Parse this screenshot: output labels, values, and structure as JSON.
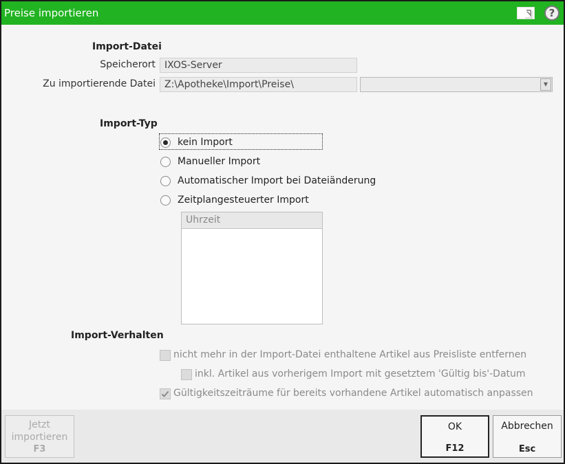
{
  "window": {
    "title": "Preise importieren",
    "help_label": "?",
    "accent": "#21b321"
  },
  "import_datei": {
    "heading": "Import-Datei",
    "speicherort_label": "Speicherort",
    "speicherort_value": "IXOS-Server",
    "datei_label": "Zu importierende Datei",
    "datei_value": "Z:\\Apotheke\\Import\\Preise\\",
    "combo_value": ""
  },
  "import_typ": {
    "heading": "Import-Typ",
    "options": [
      {
        "label": "kein Import",
        "checked": true
      },
      {
        "label": "Manueller Import",
        "checked": false
      },
      {
        "label": "Automatischer Import bei Dateiänderung",
        "checked": false
      },
      {
        "label": "Zeitplangesteuerter Import",
        "checked": false
      }
    ],
    "schedule_column": "Uhrzeit"
  },
  "import_verhalten": {
    "heading": "Import-Verhalten",
    "options": [
      {
        "label": "nicht mehr in der Import-Datei enthaltene Artikel aus Preisliste entfernen",
        "checked": false,
        "enabled": false
      },
      {
        "label": "inkl. Artikel aus vorherigem Import mit gesetztem 'Gültig bis'-Datum",
        "checked": false,
        "enabled": false
      },
      {
        "label": "Gültigkeitszeiträume für bereits vorhandene Artikel automatisch anpassen",
        "checked": true,
        "enabled": false
      }
    ]
  },
  "footer": {
    "import_now": {
      "line1": "Jetzt",
      "line2": "importieren",
      "key": "F3"
    },
    "ok": {
      "label": "OK",
      "key": "F12"
    },
    "cancel": {
      "label": "Abbrechen",
      "key": "Esc"
    }
  },
  "icons": {
    "window-icon": "window-arrow-icon",
    "help": "help-icon",
    "check": "check-icon",
    "dropdown": "chevron-down-icon"
  }
}
